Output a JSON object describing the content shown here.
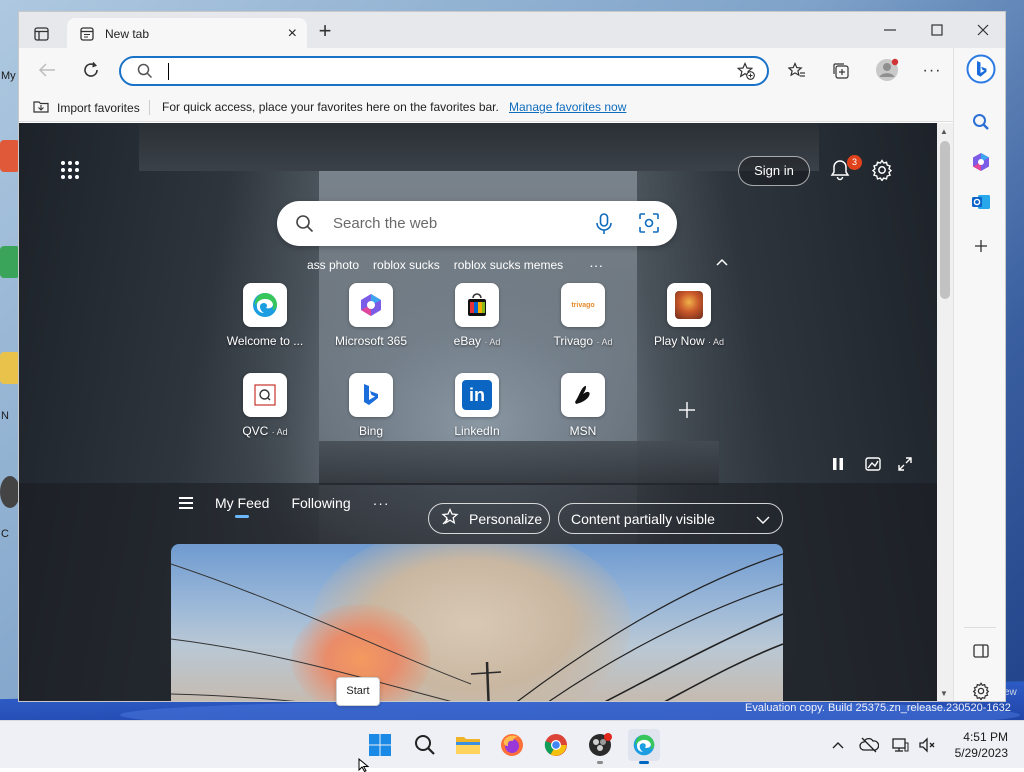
{
  "browser": {
    "tab_title": "New tab",
    "address_value": "",
    "favorites_bar": {
      "import_label": "Import favorites",
      "message": "For quick access, place your favorites here on the favorites bar.",
      "manage_link": "Manage favorites now"
    }
  },
  "newtab": {
    "sign_in_label": "Sign in",
    "notification_count": "3",
    "search_placeholder": "Search the web",
    "suggestions": [
      "ass photo",
      "roblox sucks",
      "roblox sucks memes"
    ],
    "more_label": "···",
    "quick_links": [
      {
        "label": "Welcome to ...",
        "ad": "",
        "icon": "edge-icon"
      },
      {
        "label": "Microsoft 365",
        "ad": "",
        "icon": "m365-icon"
      },
      {
        "label": "eBay",
        "ad": "· Ad",
        "icon": "ebay-icon"
      },
      {
        "label": "Trivago",
        "ad": "· Ad",
        "icon": "trivago-icon"
      },
      {
        "label": "Play Now",
        "ad": "· Ad",
        "icon": "game-icon"
      },
      {
        "label": "QVC",
        "ad": "· Ad",
        "icon": "qvc-icon"
      },
      {
        "label": "Bing",
        "ad": "",
        "icon": "bing-icon"
      },
      {
        "label": "LinkedIn",
        "ad": "",
        "icon": "linkedin-icon"
      },
      {
        "label": "MSN",
        "ad": "",
        "icon": "msn-icon"
      }
    ],
    "trivago_tile_text": "trivago",
    "linkedin_tile_text": "in",
    "feed_tabs": {
      "my_feed": "My Feed",
      "following": "Following",
      "more": "···"
    },
    "personalize_label": "Personalize",
    "content_visibility_label": "Content partially visible"
  },
  "tooltip": "Start",
  "system": {
    "time": "4:51 PM",
    "date": "5/29/2023",
    "watermark": "Evaluation copy. Build 25375.zn_release.230520-1632",
    "watermark_fragment": "ew",
    "desktop_labels": [
      "My",
      "N",
      "C"
    ]
  },
  "colors": {
    "accent": "#0067c0",
    "link": "#0f6cbd",
    "badge": "#e0421c"
  }
}
